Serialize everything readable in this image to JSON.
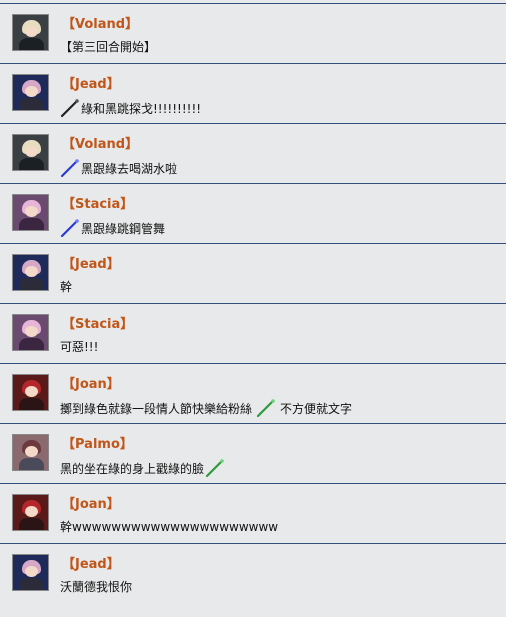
{
  "colors": {
    "name": "#c0561a",
    "divider": "#33507a",
    "background": "#e8e9ea",
    "wand_black": "#222222",
    "wand_blue": "#2a3bd8",
    "wand_green": "#2e9a3a"
  },
  "messages": [
    {
      "user": "【Voland】",
      "avatar": "voland-avatar",
      "wand": null,
      "text": "【第三回合開始】",
      "text_after": ""
    },
    {
      "user": "【Jead】",
      "avatar": "jead-avatar",
      "wand": "black",
      "text": "綠和黑跳探戈!!!!!!!!!!",
      "text_after": ""
    },
    {
      "user": "【Voland】",
      "avatar": "voland-avatar",
      "wand": "blue",
      "text": " 黑跟綠去喝湖水啦",
      "text_after": ""
    },
    {
      "user": "【Stacia】",
      "avatar": "stacia-avatar",
      "wand": "blue",
      "text": "黑跟綠跳鋼管舞",
      "text_after": ""
    },
    {
      "user": "【Jead】",
      "avatar": "jead-avatar",
      "wand": null,
      "text": "幹",
      "text_after": ""
    },
    {
      "user": "【Stacia】",
      "avatar": "stacia-avatar",
      "wand": null,
      "text": "可惡!!!",
      "text_after": ""
    },
    {
      "user": "【Joan】",
      "avatar": "joan-avatar",
      "wand": null,
      "text": "擲到綠色就錄一段情人節快樂給粉絲",
      "wand_after": "green",
      "text_after": "不方便就文字"
    },
    {
      "user": "【Palmo】",
      "avatar": "palmo-avatar",
      "wand": null,
      "text": "黑的坐在綠的身上戳綠的臉",
      "wand_after": "green",
      "text_after": ""
    },
    {
      "user": "【Joan】",
      "avatar": "joan-avatar",
      "wand": null,
      "text": "幹wwwwwwwwwwwwwwwwwwwww",
      "text_after": ""
    },
    {
      "user": "【Jead】",
      "avatar": "jead-avatar",
      "wand": null,
      "text": "沃蘭德我恨你",
      "text_after": ""
    }
  ]
}
